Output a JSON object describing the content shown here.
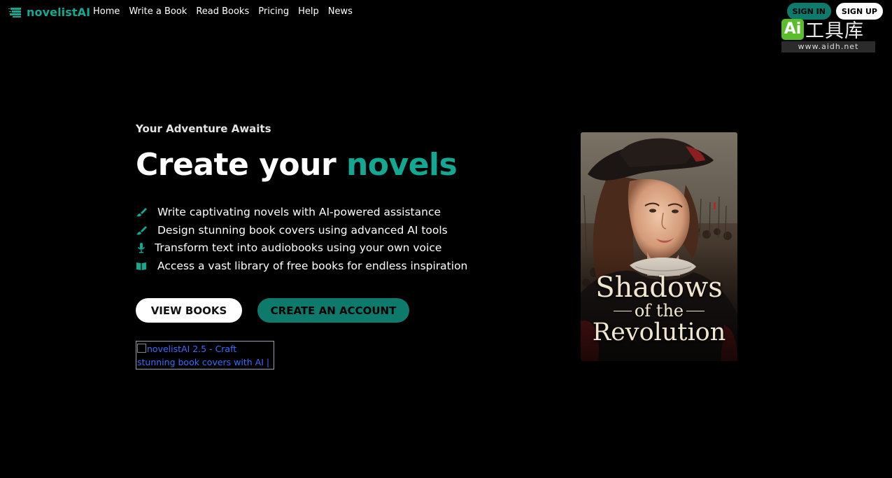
{
  "brand": {
    "name": "novelistAI",
    "accent_color": "#12a892"
  },
  "nav": [
    {
      "label": "Home"
    },
    {
      "label": "Write a Book"
    },
    {
      "label": "Read Books"
    },
    {
      "label": "Pricing"
    },
    {
      "label": "Help"
    },
    {
      "label": "News"
    }
  ],
  "auth": {
    "signin_label": "SIGN IN",
    "signup_label": "SIGN UP"
  },
  "watermark": {
    "badge": "Ai",
    "cn_text": "工具库",
    "url": "www.aidh.net"
  },
  "hero": {
    "tagline": "Your Adventure Awaits",
    "headline_main": "Create your",
    "headline_accent": "novels",
    "features": [
      {
        "icon": "brush-icon",
        "text": "Write captivating novels with AI-powered assistance"
      },
      {
        "icon": "brush-icon",
        "text": "Design stunning book covers using advanced AI tools"
      },
      {
        "icon": "microphone-icon",
        "text": "Transform text into audiobooks using your own voice"
      },
      {
        "icon": "book-open-icon",
        "text": "Access a vast library of free books for endless inspiration"
      }
    ],
    "view_books_label": "VIEW BOOKS",
    "create_account_label": "CREATE AN ACCOUNT",
    "product_badge_alt": "novelistAI 2.5 - Craft stunning book covers with AI | Product"
  },
  "cover": {
    "title_line1": "Shadows",
    "title_line2": "of the",
    "title_line3": "Revolution"
  }
}
